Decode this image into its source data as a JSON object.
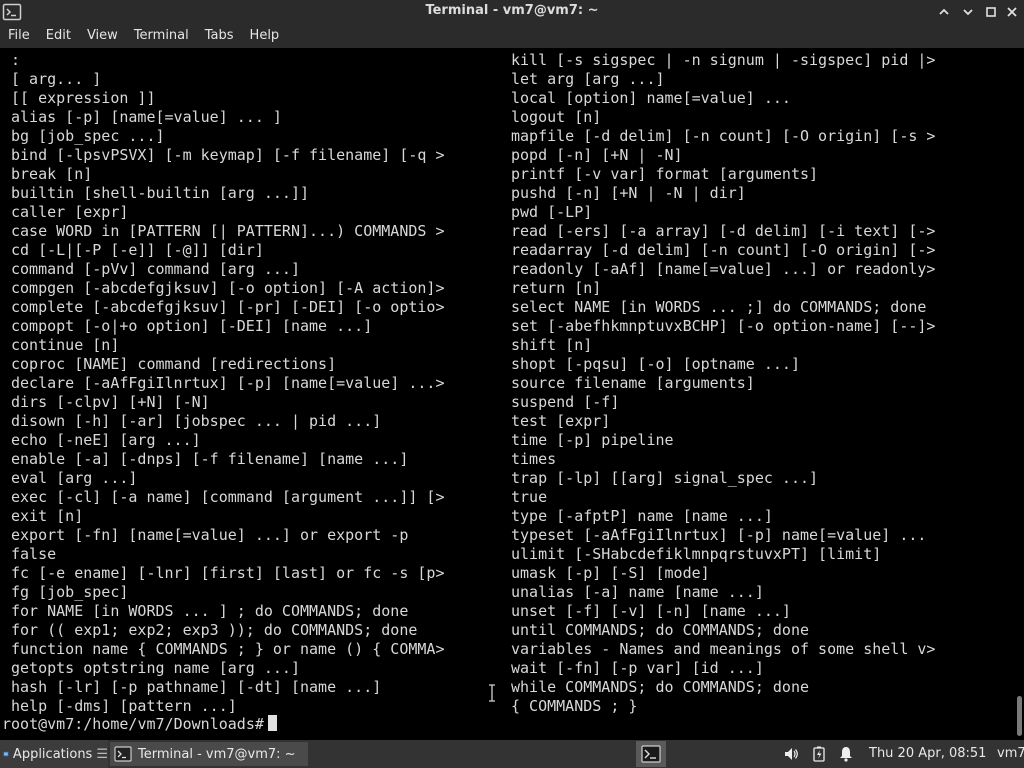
{
  "window": {
    "title": "Terminal - vm7@vm7: ~",
    "buttons": {
      "minimize": "⌃",
      "restore": "⌄",
      "maximize": "□",
      "close": "✕"
    }
  },
  "menu": {
    "items": [
      "File",
      "Edit",
      "View",
      "Terminal",
      "Tabs",
      "Help"
    ]
  },
  "terminal": {
    "left_column": [
      ":",
      "[ arg... ]",
      "[[ expression ]]",
      "alias [-p] [name[=value] ... ]",
      "bg [job_spec ...]",
      "bind [-lpsvPSVX] [-m keymap] [-f filename] [-q >",
      "break [n]",
      "builtin [shell-builtin [arg ...]]",
      "caller [expr]",
      "case WORD in [PATTERN [| PATTERN]...) COMMANDS >",
      "cd [-L|[-P [-e]] [-@]] [dir]",
      "command [-pVv] command [arg ...]",
      "compgen [-abcdefgjksuv] [-o option] [-A action]>",
      "complete [-abcdefgjksuv] [-pr] [-DEI] [-o optio>",
      "compopt [-o|+o option] [-DEI] [name ...]",
      "continue [n]",
      "coproc [NAME] command [redirections]",
      "declare [-aAfFgiIlnrtux] [-p] [name[=value] ...>",
      "dirs [-clpv] [+N] [-N]",
      "disown [-h] [-ar] [jobspec ... | pid ...]",
      "echo [-neE] [arg ...]",
      "enable [-a] [-dnps] [-f filename] [name ...]",
      "eval [arg ...]",
      "exec [-cl] [-a name] [command [argument ...]] [>",
      "exit [n]",
      "export [-fn] [name[=value] ...] or export -p",
      "false",
      "fc [-e ename] [-lnr] [first] [last] or fc -s [p>",
      "fg [job_spec]",
      "for NAME [in WORDS ... ] ; do COMMANDS; done",
      "for (( exp1; exp2; exp3 )); do COMMANDS; done",
      "function name { COMMANDS ; } or name () { COMMA>",
      "getopts optstring name [arg ...]",
      "hash [-lr] [-p pathname] [-dt] [name ...]",
      "help [-dms] [pattern ...]"
    ],
    "right_column": [
      "kill [-s sigspec | -n signum | -sigspec] pid |>",
      "let arg [arg ...]",
      "local [option] name[=value] ...",
      "logout [n]",
      "mapfile [-d delim] [-n count] [-O origin] [-s >",
      "popd [-n] [+N | -N]",
      "printf [-v var] format [arguments]",
      "pushd [-n] [+N | -N | dir]",
      "pwd [-LP]",
      "read [-ers] [-a array] [-d delim] [-i text] [->",
      "readarray [-d delim] [-n count] [-O origin] [->",
      "readonly [-aAf] [name[=value] ...] or readonly>",
      "return [n]",
      "select NAME [in WORDS ... ;] do COMMANDS; done",
      "set [-abefhkmnptuvxBCHP] [-o option-name] [--]>",
      "shift [n]",
      "shopt [-pqsu] [-o] [optname ...]",
      "source filename [arguments]",
      "suspend [-f]",
      "test [expr]",
      "time [-p] pipeline",
      "times",
      "trap [-lp] [[arg] signal_spec ...]",
      "true",
      "type [-afptP] name [name ...]",
      "typeset [-aAfFgiIlnrtux] [-p] name[=value] ...",
      "ulimit [-SHabcdefiklmnpqrstuvxPT] [limit]",
      "umask [-p] [-S] [mode]",
      "unalias [-a] name [name ...]",
      "unset [-f] [-v] [-n] [name ...]",
      "until COMMANDS; do COMMANDS; done",
      "variables - Names and meanings of some shell v>",
      "wait [-fn] [-p var] [id ...]",
      "while COMMANDS; do COMMANDS; done",
      "{ COMMANDS ; }"
    ],
    "prompt": "root@vm7:/home/vm7/Downloads#"
  },
  "taskbar": {
    "applications_label": "Applications",
    "task_label": "Terminal - vm7@vm7: ~",
    "clock": "Thu 20 Apr, 08:51",
    "user": "vm7"
  },
  "icons": {
    "app": "terminal-icon",
    "tray": [
      "volume-icon",
      "battery-icon",
      "notification-bell-icon"
    ]
  }
}
